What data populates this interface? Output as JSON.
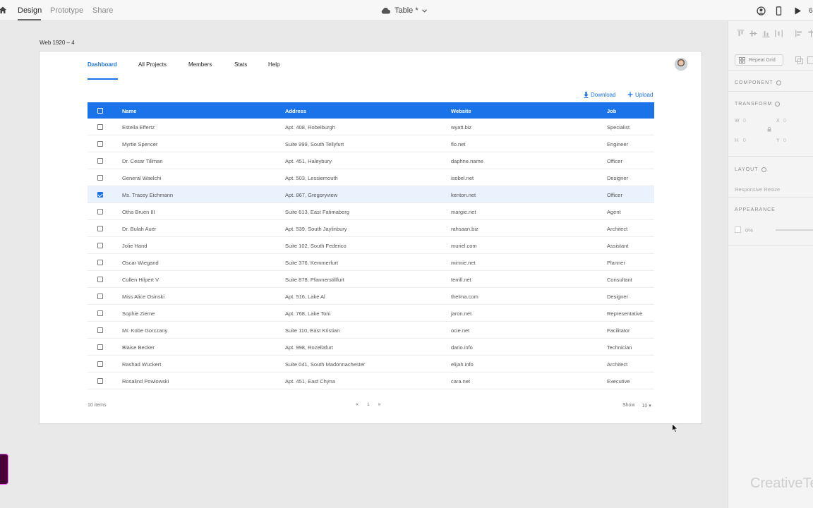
{
  "topbar": {
    "tabs": [
      "Design",
      "Prototype",
      "Share"
    ],
    "active_tab": "Design",
    "doc_title": "Table *",
    "trailing_text": "6"
  },
  "artboard": {
    "label": "Web 1920 – 4",
    "nav": [
      "Dashboard",
      "All Projects",
      "Members",
      "Stats",
      "Help"
    ],
    "active_nav": "Dashboard",
    "actions": {
      "download": "Download",
      "upload": "Upload"
    },
    "table": {
      "columns": [
        "Name",
        "Address",
        "Website",
        "Job"
      ],
      "rows": [
        {
          "name": "Estella Effertz",
          "address": "Apt. 408, Robelburgh",
          "website": "wyatt.biz",
          "job": "Specialist",
          "checked": false
        },
        {
          "name": "Myrtie Spencer",
          "address": "Suite 999, South Tellyfurt",
          "website": "flo.net",
          "job": "Engineer",
          "checked": false
        },
        {
          "name": "Dr. Cesar Tillman",
          "address": "Apt. 451, Haleybury",
          "website": "daphne.name",
          "job": "Officer",
          "checked": false
        },
        {
          "name": "General Waelchi",
          "address": "Apt. 503, Lessiemouth",
          "website": "isobel.net",
          "job": "Designer",
          "checked": false
        },
        {
          "name": "Ms. Tracey Eichmann",
          "address": "Apt. 867, Gregoryview",
          "website": "kenton.net",
          "job": "Officer",
          "checked": true
        },
        {
          "name": "Otha Bruen III",
          "address": "Suite 613, East Fatimaberg",
          "website": "margie.net",
          "job": "Agent",
          "checked": false
        },
        {
          "name": "Dr. Bulah Auer",
          "address": "Apt. 539, South Jaylinbury",
          "website": "rahsaan.biz",
          "job": "Architect",
          "checked": false
        },
        {
          "name": "Jolie Hand",
          "address": "Suite 102, South Federico",
          "website": "muriel.com",
          "job": "Assistant",
          "checked": false
        },
        {
          "name": "Oscar Wiegand",
          "address": "Suite 376, Kemmerfurt",
          "website": "minnie.net",
          "job": "Planner",
          "checked": false
        },
        {
          "name": "Cullen Hilpert V",
          "address": "Suite 878, Pfannerstillfurt",
          "website": "terrill.net",
          "job": "Consultant",
          "checked": false
        },
        {
          "name": "Miss Alice Osinski",
          "address": "Apt. 516, Lake Al",
          "website": "thelma.com",
          "job": "Designer",
          "checked": false
        },
        {
          "name": "Sophie Zieme",
          "address": "Apt. 768, Lake Toni",
          "website": "jaron.net",
          "job": "Representative",
          "checked": false
        },
        {
          "name": "Mr. Kobe Gorczany",
          "address": "Suite 110, East Kristian",
          "website": "ocie.net",
          "job": "Facilitator",
          "checked": false
        },
        {
          "name": "Blaise Becker",
          "address": "Apt. 998, Rozellafurt",
          "website": "dario.info",
          "job": "Technician",
          "checked": false
        },
        {
          "name": "Rashad Wuckert",
          "address": "Suite 041, South Madonnachester",
          "website": "elijah.info",
          "job": "Architect",
          "checked": false
        },
        {
          "name": "Rosalind Powlowski",
          "address": "Apt. 451, East Chyna",
          "website": "cara.net",
          "job": "Executive",
          "checked": false
        }
      ]
    },
    "footer": {
      "count": "10 items",
      "page": "1",
      "show_label": "Show",
      "show_value": "10 ▾"
    }
  },
  "panel": {
    "repeat_grid": "Repeat Grid",
    "component": "COMPONENT",
    "transform": "TRANSFORM",
    "w_label": "W",
    "w_value": "0",
    "x_label": "X",
    "x_value": "0",
    "h_label": "H",
    "h_value": "0",
    "y_label": "Y",
    "y_value": "0",
    "layout": "LAYOUT",
    "responsive_resize": "Responsive Resize",
    "appearance": "APPEARANCE",
    "opacity": "0%",
    "watermark": "CreativeTe"
  },
  "colors": {
    "accent": "#1a73e8",
    "selected_row": "#eaf2fd"
  }
}
